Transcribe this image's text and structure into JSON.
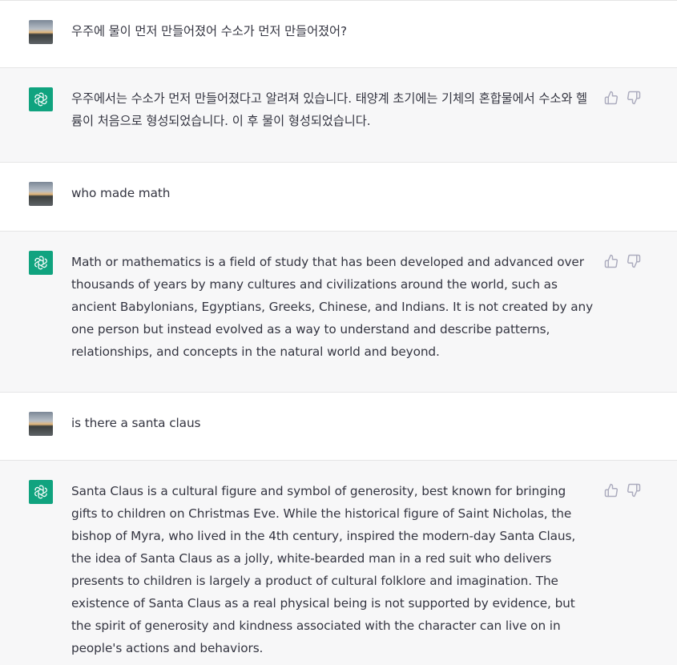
{
  "conversation": [
    {
      "role": "user",
      "text": "우주에 물이 먼저 만들어졌어 수소가 먼저 만들어졌어?"
    },
    {
      "role": "assistant",
      "text": "우주에서는 수소가 먼저 만들어졌다고 알려져 있습니다. 태양계 초기에는 기체의 혼합물에서 수소와 헬륨이 처음으로 형성되었습니다. 이 후 물이 형성되었습니다."
    },
    {
      "role": "user",
      "text": "who made math"
    },
    {
      "role": "assistant",
      "text": "Math or mathematics is a field of study that has been developed and advanced over thousands of years by many cultures and civilizations around the world, such as ancient Babylonians, Egyptians, Greeks, Chinese, and Indians. It is not created by any one person but instead evolved as a way to understand and describe patterns, relationships, and concepts in the natural world and beyond."
    },
    {
      "role": "user",
      "text": "is there a santa claus"
    },
    {
      "role": "assistant",
      "text": "Santa Claus is a cultural figure and symbol of generosity, best known for bringing gifts to children on Christmas Eve. While the historical figure of Saint Nicholas, the bishop of Myra, who lived in the 4th century, inspired the modern-day Santa Claus, the idea of Santa Claus as a jolly, white-bearded man in a red suit who delivers presents to children is largely a product of cultural folklore and imagination. The existence of Santa Claus as a real physical being is not supported by evidence, but the spirit of generosity and kindness associated with the character can live on in people's actions and behaviors."
    }
  ],
  "icons": {
    "user_avatar": "user-avatar-sunset-photo",
    "assistant_avatar": "openai-logo-icon",
    "like": "thumbs-up-icon",
    "dislike": "thumbs-down-icon"
  },
  "colors": {
    "assistant_avatar_bg": "#10a37f",
    "assistant_row_bg": "#f7f7f8",
    "text": "#343541",
    "icon": "#acacbe"
  }
}
